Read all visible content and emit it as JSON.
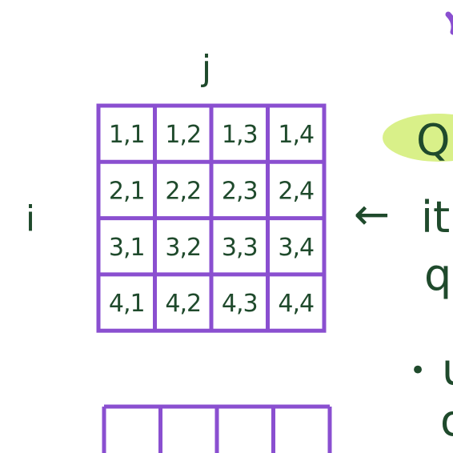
{
  "matrix": {
    "col_label": "j",
    "row_label": "i",
    "cells": [
      [
        "1,1",
        "1,2",
        "1,3",
        "1,4"
      ],
      [
        "2,1",
        "2,2",
        "2,3",
        "2,4"
      ],
      [
        "3,1",
        "3,2",
        "3,3",
        "3,4"
      ],
      [
        "4,1",
        "4,2",
        "4,3",
        "4,4"
      ]
    ],
    "bottom_array_cells": 4
  },
  "annotations": {
    "arrow": "←",
    "highlight_text": "Q",
    "line1": "it",
    "line2": "q",
    "bullet": "•",
    "bullet_text": "u",
    "line4": "o"
  },
  "colors": {
    "grid": "#8a4fd0",
    "ink": "#1f4a2c",
    "highlight": "#d9f089",
    "purple_mark": "#8a4fd0"
  }
}
